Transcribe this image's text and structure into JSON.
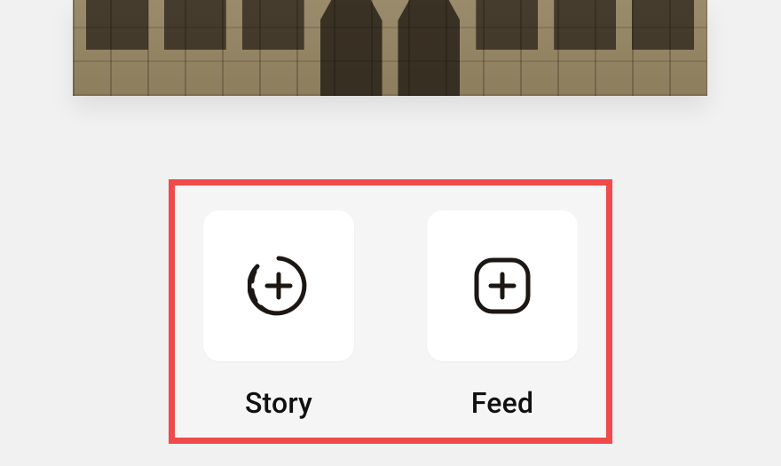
{
  "share": {
    "options": [
      {
        "label": "Story",
        "icon": "story-plus-icon"
      },
      {
        "label": "Feed",
        "icon": "feed-plus-icon"
      }
    ]
  }
}
